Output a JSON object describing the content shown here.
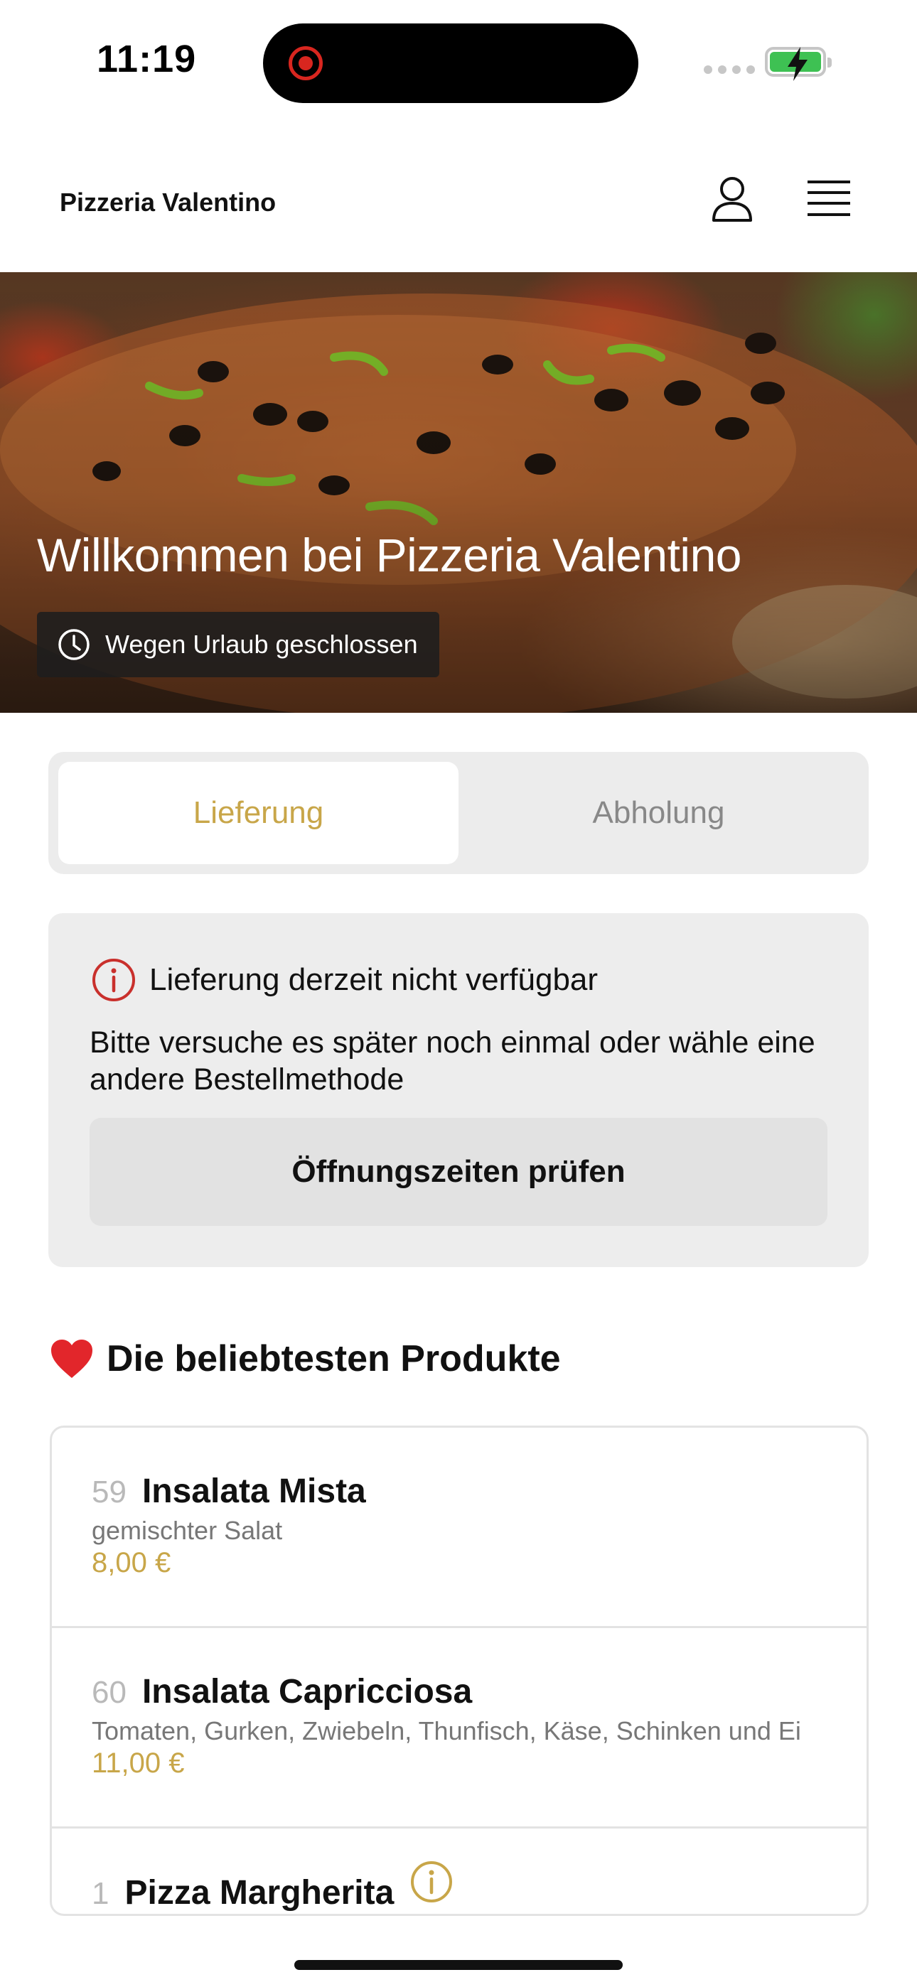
{
  "status_bar": {
    "time": "11:19",
    "icons": [
      "screen-recording-icon",
      "cellular-dots-icon",
      "battery-charging-icon"
    ],
    "battery_color": "#3ec153",
    "record_color": "#d8261f"
  },
  "header": {
    "title": "Pizzeria Valentino",
    "icons": [
      "user-icon",
      "menu-icon"
    ]
  },
  "hero": {
    "title": "Willkommen bei Pizzeria Valentino",
    "status_badge": "Wegen Urlaub geschlossen",
    "status_icon": "clock-icon"
  },
  "order_method": {
    "tabs": [
      {
        "label": "Lieferung",
        "active": true
      },
      {
        "label": "Abholung",
        "active": false
      }
    ],
    "accent_color": "#c8a649"
  },
  "alert": {
    "icon": "info-icon",
    "title": "Lieferung derzeit nicht verfügbar",
    "body": "Bitte versuche es später noch einmal oder wähle eine andere Bestellmethode",
    "button_label": "Öffnungszeiten prüfen",
    "icon_color": "#c9302c"
  },
  "popular": {
    "title": "Die beliebtesten Produkte",
    "icon": "heart-icon",
    "products": [
      {
        "number": "59",
        "name": "Insalata Mista",
        "description": "gemischter Salat",
        "price": "8,00 €"
      },
      {
        "number": "60",
        "name": "Insalata Capricciosa",
        "description": "Tomaten, Gurken, Zwiebeln, Thunfisch, Käse, Schinken und Ei",
        "price": "11,00 €"
      },
      {
        "number": "1",
        "name": "Pizza Margherita",
        "description": "",
        "price": "",
        "has_info_icon": true
      }
    ]
  }
}
